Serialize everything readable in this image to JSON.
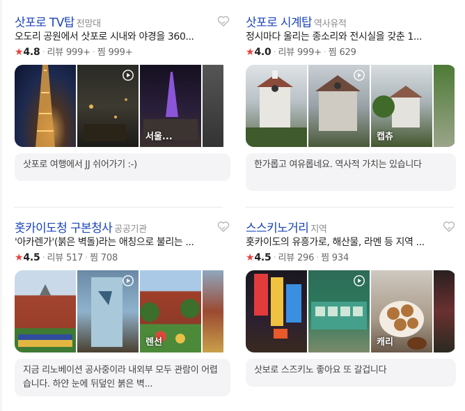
{
  "cards": [
    {
      "title": "삿포로 TV탑",
      "category": "전망대",
      "description": "오도리 공원에서 삿포로 시내와 야경을 360...",
      "rating": "4.8",
      "reviews": "리뷰 999+",
      "saves": "찜 999+",
      "photo_labels": [
        "",
        "",
        "서울...",
        ""
      ],
      "review": "삿포로 여행에서 JJ 쉬어가기 :-)"
    },
    {
      "title": "삿포로 시계탑",
      "category": "역사유적",
      "description": "정시마다 울리는 종소리와 전시실을 갖춘 1...",
      "rating": "4.0",
      "reviews": "리뷰 999+",
      "saves": "찜 629",
      "photo_labels": [
        "",
        "",
        "캡츄",
        ""
      ],
      "review": "한가롭고 여유롭네요. 역사적 가치는 있습니다"
    },
    {
      "title": "홋카이도청 구본청사",
      "category": "공공기관",
      "description": "'아카렌가'(붉은 벽돌)라는 애칭으로 불리는 ...",
      "rating": "4.5",
      "reviews": "리뷰 517",
      "saves": "찜 708",
      "photo_labels": [
        "",
        "",
        "렌선",
        ""
      ],
      "review": "지금 리노베이션 공사중이라 내외부 모두 관람이 어렵습니다. 하얀 눈에 뒤덮인 붉은 벽..."
    },
    {
      "title": "스스키노거리",
      "category": "지역",
      "description": "홋카이도의 유흥가로, 해산물, 라멘 등 지역 ...",
      "rating": "4.5",
      "reviews": "리뷰 296",
      "saves": "찜 934",
      "photo_labels": [
        "",
        "",
        "캐리",
        ""
      ],
      "review": "삿보로 스즈키노 좋아요 또 갈겁니다"
    }
  ],
  "icons": {
    "heart": "heart-outline-icon",
    "play": "play-circle-icon",
    "star": "star-icon"
  },
  "colors": {
    "title": "#1a44b8",
    "star": "#e8413b",
    "review_bg": "#f4f4f6"
  }
}
